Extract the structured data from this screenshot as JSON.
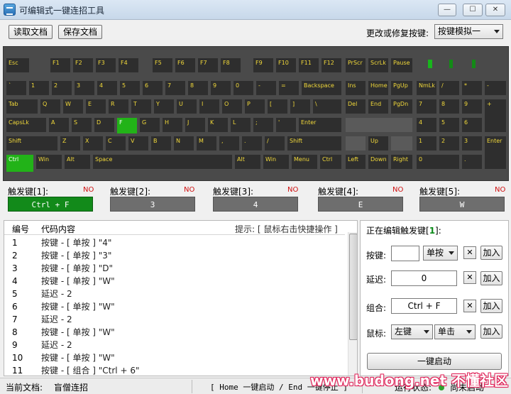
{
  "window": {
    "title": "可编辑式一键连招工具",
    "min": "—",
    "max": "☐",
    "close": "✕"
  },
  "toolbar": {
    "read_label": "读取文档",
    "save_label": "保存文档",
    "mode_label": "更改或修复按键:",
    "mode_value": "按键模拟一"
  },
  "keyboard": {
    "row_fn": [
      "Esc",
      "F1",
      "F2",
      "F3",
      "F4",
      "F5",
      "F6",
      "F7",
      "F8",
      "F9",
      "F10",
      "F11",
      "F12",
      "PrScr",
      "ScrLk",
      "Pause"
    ],
    "row_num": [
      "`",
      "1",
      "2",
      "3",
      "4",
      "5",
      "6",
      "7",
      "8",
      "9",
      "0",
      "-",
      "=",
      "Backspace",
      "Ins",
      "Home",
      "PgUp",
      "NmLk",
      "/",
      "*",
      "-"
    ],
    "row_tab": [
      "Tab",
      "Q",
      "W",
      "E",
      "R",
      "T",
      "Y",
      "U",
      "I",
      "O",
      "P",
      "[",
      "]",
      "\\",
      "Del",
      "End",
      "PgDn",
      "7",
      "8",
      "9",
      "+"
    ],
    "row_caps": [
      "CapsLk",
      "A",
      "S",
      "D",
      "F",
      "G",
      "H",
      "J",
      "K",
      "L",
      ";",
      "'",
      "Enter",
      "4",
      "5",
      "6"
    ],
    "row_shift": [
      "Shift",
      "Z",
      "X",
      "C",
      "V",
      "B",
      "N",
      "M",
      ",",
      ".",
      "/",
      "Shift",
      "Up",
      "1",
      "2",
      "3",
      "Enter"
    ],
    "row_ctrl": [
      "Ctrl",
      "Win",
      "Alt",
      "Space",
      "Alt",
      "Win",
      "Menu",
      "Ctrl",
      "Left",
      "Down",
      "Right",
      "0",
      "."
    ]
  },
  "triggers": [
    {
      "label": "触发键[1]:",
      "status": "NO",
      "value": "Ctrl + F"
    },
    {
      "label": "触发键[2]:",
      "status": "NO",
      "value": "3"
    },
    {
      "label": "触发键[3]:",
      "status": "NO",
      "value": "4"
    },
    {
      "label": "触发键[4]:",
      "status": "NO",
      "value": "E"
    },
    {
      "label": "触发键[5]:",
      "status": "NO",
      "value": "W"
    }
  ],
  "list": {
    "col_num": "编号",
    "col_code": "代码内容",
    "hint": "提示: [ 鼠标右击快捷操作 ]",
    "rows": [
      {
        "num": "1",
        "code": "按键 - [ 单按 ] \"4\""
      },
      {
        "num": "2",
        "code": "按键 - [ 单按 ] \"3\""
      },
      {
        "num": "3",
        "code": "按键 - [ 单按 ] \"D\""
      },
      {
        "num": "4",
        "code": "按键 - [ 单按 ] \"W\""
      },
      {
        "num": "5",
        "code": "延迟 - 2"
      },
      {
        "num": "6",
        "code": "按键 - [ 单按 ] \"W\""
      },
      {
        "num": "7",
        "code": "延迟 - 2"
      },
      {
        "num": "8",
        "code": "按键 - [ 单按 ] \"W\""
      },
      {
        "num": "9",
        "code": "延迟 - 2"
      },
      {
        "num": "10",
        "code": "按键 - [ 单按 ] \"W\""
      },
      {
        "num": "11",
        "code": "按键 - [ 组合 ] \"Ctrl + 6\""
      }
    ]
  },
  "editor": {
    "heading_prefix": "正在编辑触发键[",
    "heading_index": "1",
    "heading_suffix": "]:",
    "key_label": "按键:",
    "key_value": "",
    "key_mode": "单按",
    "delay_label": "延迟:",
    "delay_value": "0",
    "combo_label": "组合:",
    "combo_value": "Ctrl + F",
    "mouse_label": "鼠标:",
    "mouse_button": "左键",
    "mouse_mode": "单击",
    "clear": "✕",
    "add": "加入",
    "start": "一键启动"
  },
  "status": {
    "doc_label": "当前文档:",
    "doc_value": "盲僧连招",
    "shortcut_hint": "[ Home 一键启动 / End 一键停止 ]",
    "run_label": "运行状态:",
    "run_value": "尚未启动"
  },
  "watermark": "www.budong.net 不懂社区"
}
